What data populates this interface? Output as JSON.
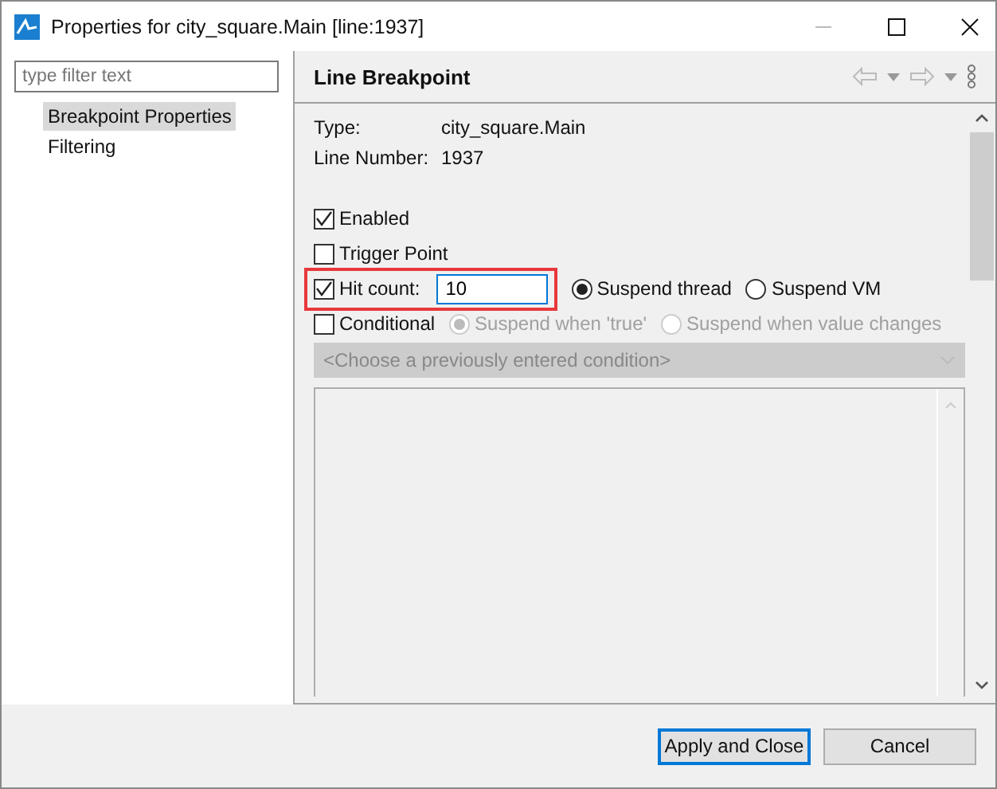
{
  "window": {
    "title": "Properties for city_square.Main [line:1937]"
  },
  "filter": {
    "placeholder": "type filter text"
  },
  "tree": [
    {
      "label": "Breakpoint Properties",
      "selected": true
    },
    {
      "label": "Filtering",
      "selected": false
    }
  ],
  "page": {
    "title": "Line Breakpoint"
  },
  "info": [
    {
      "label": "Type:",
      "value": "city_square.Main"
    },
    {
      "label": "Line Number:",
      "value": "1937"
    }
  ],
  "checks": [
    {
      "label": "Enabled",
      "checked": true
    },
    {
      "label": "Trigger Point",
      "checked": false
    }
  ],
  "hit_count": {
    "label": "Hit count:",
    "checked": true,
    "value": "10",
    "highlighted": true,
    "radios": [
      {
        "label": "Suspend thread",
        "selected": true,
        "disabled": false
      },
      {
        "label": "Suspend VM",
        "selected": false,
        "disabled": false
      }
    ]
  },
  "conditional": {
    "label": "Conditional",
    "checked": false,
    "radios": [
      {
        "label": "Suspend when 'true'",
        "selected": true,
        "disabled": true
      },
      {
        "label": "Suspend when value changes",
        "selected": false,
        "disabled": true
      }
    ],
    "condition_combo": {
      "value": "<Choose a previously entered condition>",
      "disabled": true
    }
  },
  "buttons": [
    {
      "label": "Apply and Close",
      "default": true
    },
    {
      "label": "Cancel",
      "default": false
    }
  ]
}
